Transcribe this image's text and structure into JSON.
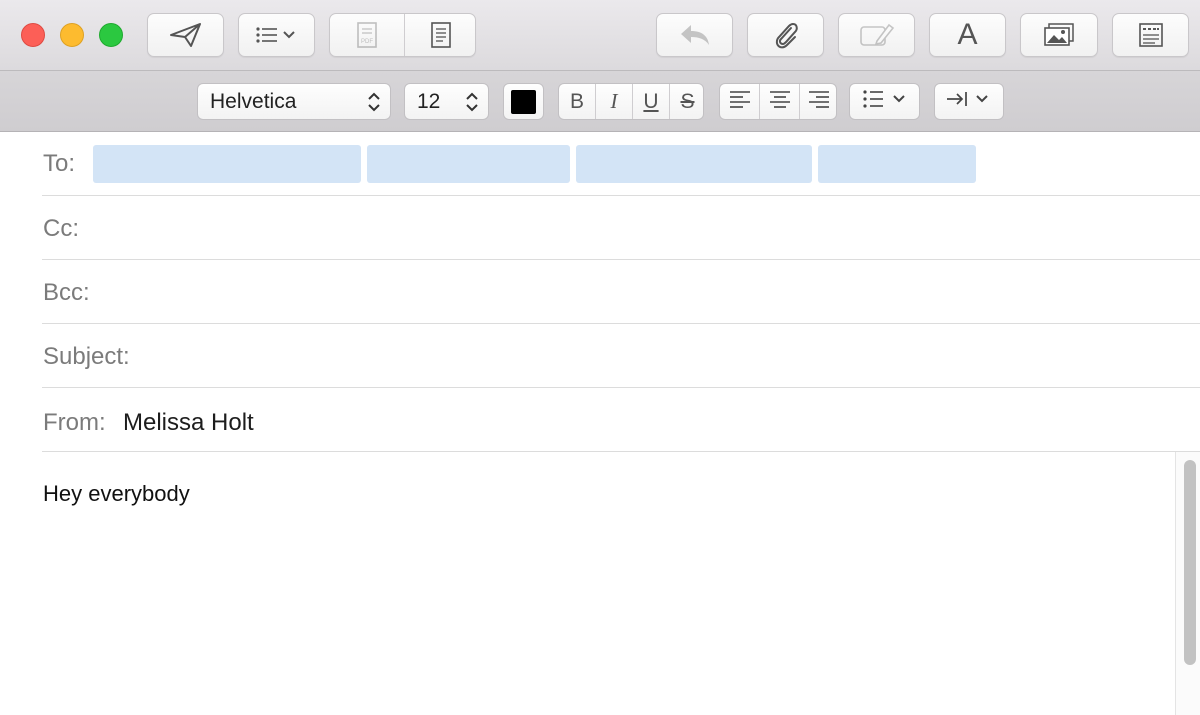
{
  "window": {
    "traffic_lights": {
      "close": "#fc5f57",
      "minimize": "#fdbb2f",
      "maximize": "#2bc840"
    }
  },
  "toolbar": {
    "buttons": [
      {
        "name": "send",
        "icon": "paper-plane-icon"
      },
      {
        "name": "header-fields",
        "icon": "list-chevron-icon"
      },
      {
        "name": "pdf-attach",
        "icon": "pdf-document-icon"
      },
      {
        "name": "stationery",
        "icon": "document-lines-icon"
      },
      {
        "name": "reply",
        "icon": "reply-arrow-icon"
      },
      {
        "name": "attach",
        "icon": "paperclip-icon"
      },
      {
        "name": "markup",
        "icon": "markup-pen-icon"
      },
      {
        "name": "fonts",
        "icon": "letter-a-icon",
        "label": "A"
      },
      {
        "name": "photo-browser",
        "icon": "photo-browser-icon"
      },
      {
        "name": "format-bar-toggle",
        "icon": "format-bar-icon"
      }
    ]
  },
  "format_bar": {
    "font_family": "Helvetica",
    "font_size": "12",
    "text_color": "#000000",
    "style_buttons": {
      "bold": "B",
      "italic": "I",
      "underline": "U",
      "strikethrough": "S"
    },
    "alignment_icons": [
      "align-left-icon",
      "align-center-icon",
      "align-right-icon"
    ],
    "list_icon": "bullet-list-icon",
    "indent_icon": "indent-icon"
  },
  "headers": {
    "to_label": "To:",
    "cc_label": "Cc:",
    "bcc_label": "Bcc:",
    "subject_label": "Subject:",
    "from_label": "From:",
    "from_value": "Melissa Holt",
    "recipient_chip_color": "#d3e4f6"
  },
  "message": {
    "body": "Hey everybody"
  },
  "colors": {
    "toolbar_bg": "#e3e1e4",
    "formatbar_bg": "#d3d1d4",
    "field_label": "#7b7b7b"
  }
}
